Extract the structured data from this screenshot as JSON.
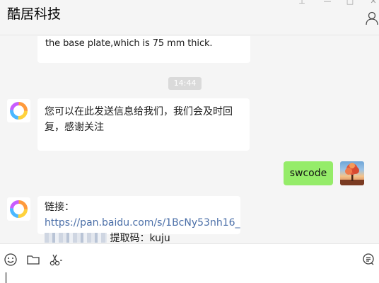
{
  "window": {
    "title": "酷居科技",
    "controls": {
      "pin": "⊥",
      "minimize": "—",
      "maximize": "□",
      "close": "✕"
    }
  },
  "messages": [
    {
      "sender": "contact",
      "type": "text-clipped",
      "text": "the base plate,which is 75 mm thick."
    },
    {
      "type": "time",
      "text": "14:44"
    },
    {
      "sender": "contact",
      "type": "text",
      "text": "您可以在此发送信息给我们，我们会及时回复，感谢关注"
    },
    {
      "sender": "self",
      "type": "text",
      "text": "swcode"
    },
    {
      "sender": "contact",
      "type": "link",
      "prefix": "链接：",
      "url_visible": "https://pan.baidu.com/s/1BcNy53nh16_",
      "code_label": "提取码：",
      "code": "kuju"
    }
  ],
  "toolbar": {
    "icons": [
      "emoji-icon",
      "folder-icon",
      "scissors-icon",
      "chat-history-icon"
    ]
  },
  "colors": {
    "self_bubble": "#95ec69",
    "contact_bubble": "#ffffff",
    "link": "#4b6fa8",
    "background": "#f5f5f5"
  }
}
